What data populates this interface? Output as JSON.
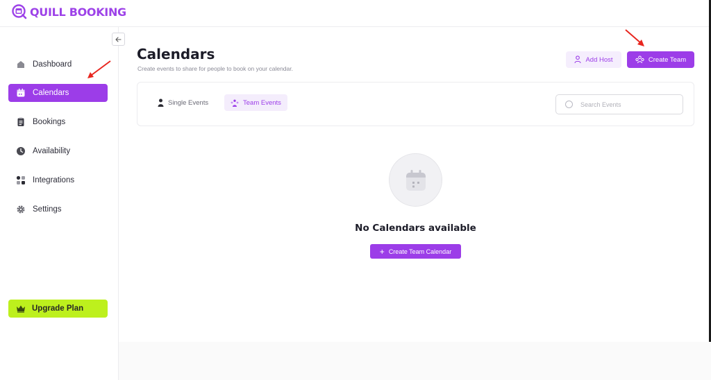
{
  "app": {
    "logo_text": "QUILL BOOKING"
  },
  "sidebar": {
    "items": [
      {
        "label": "Dashboard",
        "icon": "home-icon"
      },
      {
        "label": "Calendars",
        "icon": "calendar-icon",
        "active": true
      },
      {
        "label": "Bookings",
        "icon": "clipboard-icon"
      },
      {
        "label": "Availability",
        "icon": "clock-icon"
      },
      {
        "label": "Integrations",
        "icon": "apps-icon"
      },
      {
        "label": "Settings",
        "icon": "gear-icon"
      }
    ],
    "upgrade_label": "Upgrade Plan",
    "upgrade_icon": "crown-icon"
  },
  "header": {
    "title": "Calendars",
    "subtitle": "Create events to share for people to book on your calendar."
  },
  "actions": {
    "add_host_label": "Add Host",
    "create_team_label": "Create Team"
  },
  "tabs": [
    {
      "label": "Single Events",
      "icon": "user-icon"
    },
    {
      "label": "Team Events",
      "icon": "team-icon",
      "active": true
    }
  ],
  "search": {
    "placeholder": "Search Events",
    "value": ""
  },
  "empty_state": {
    "title": "No Calendars available",
    "button_label": "Create Team Calendar",
    "icon": "calendar-icon"
  },
  "colors": {
    "accent": "#9c3de8",
    "accent_light": "#f4edfc",
    "upgrade": "#bdf01d",
    "annotation_arrow": "#e8261f"
  }
}
